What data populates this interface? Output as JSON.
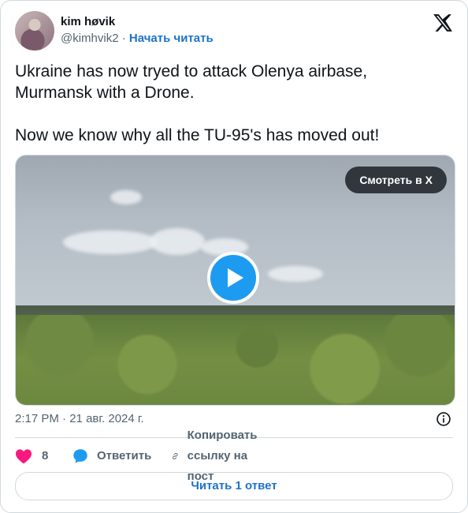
{
  "author": {
    "display_name": "kim høvik",
    "handle": "@kimhvik2",
    "separator": "·",
    "follow_label": "Начать читать"
  },
  "tweet": {
    "line1": "Ukraine has now tryed to attack Olenya airbase, Murmansk with a Drone.",
    "line2": "Now we know why all the TU-95's has moved out!"
  },
  "media": {
    "watch_label": "Смотреть в X"
  },
  "meta": {
    "time": "2:17 PM",
    "separator": "·",
    "date": "21 авг. 2024 г."
  },
  "actions": {
    "likes": "8",
    "reply_label": "Ответить",
    "copy_label": "Копировать ссылку на пост"
  },
  "read_replies_label": "Читать 1 ответ",
  "colors": {
    "accent": "#1d9bf0",
    "link": "#1d73c8",
    "like": "#f91880",
    "muted": "#536471"
  }
}
